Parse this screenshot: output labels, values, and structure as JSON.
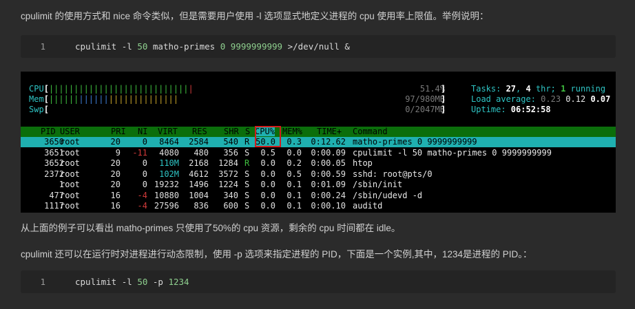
{
  "article": {
    "intro": "cpulimit 的使用方式和 nice 命令类似，但是需要用户使用 -l 选项显式地定义进程的 cpu 使用率上限值。举例说明：",
    "code1": {
      "line_no": "1",
      "cmd": "cpulimit -l ",
      "num1": "50",
      "mid": " matho-primes ",
      "num2": "0",
      "sp": " ",
      "num3": "9999999999",
      "tail": " >/dev/null &"
    },
    "after": "从上面的例子可以看出 matho-primes 只使用了50%的 cpu 资源，剩余的 cpu 时间都在 idle。",
    "dynamic": "cpulimit 还可以在运行时对进程进行动态限制，使用 -p 选项来指定进程的 PID，下面是一个实例,其中，1234是进程的 PID。：",
    "code2": {
      "line_no": "1",
      "cmd": "cpulimit -l ",
      "num1": "50",
      "mid": " -p ",
      "num2": "1234"
    }
  },
  "terminal": {
    "cpu_label": "CPU",
    "mem_label": "Mem",
    "swp_label": "Swp",
    "cpu_value": "51.4%",
    "mem_value": "97/980MB",
    "swp_value": "0/2047MB",
    "cpu_fraction": 0.514,
    "mem_fraction": 0.099,
    "swp_fraction": 0.0,
    "tasks_label": "Tasks: ",
    "tasks_count": "27",
    "tasks_sep": ", ",
    "threads_count": "4",
    "threads_label": " thr; ",
    "running_count": "1",
    "running_label": " running",
    "load_label": "Load average: ",
    "load1": "0.23",
    "load5": "0.12",
    "load15": "0.07",
    "uptime_label": "Uptime: ",
    "uptime": "06:52:58",
    "columns": [
      "PID",
      "USER",
      "PRI",
      "NI",
      "VIRT",
      "RES",
      "SHR",
      "S",
      "CPU%",
      "MEM%",
      "TIME+",
      "Command"
    ],
    "processes": [
      {
        "pid": "3650",
        "user": "root",
        "pri": "20",
        "ni": "0",
        "virt": "8464",
        "res": "2584",
        "shr": "540",
        "s": "R",
        "cpu": "50.0",
        "mem": "0.3",
        "time": "0:12.62",
        "cmd": "matho-primes 0 9999999999"
      },
      {
        "pid": "3651",
        "user": "root",
        "pri": "9",
        "ni": "-11",
        "virt": "4080",
        "res": "480",
        "shr": "356",
        "s": "S",
        "cpu": "0.5",
        "mem": "0.0",
        "time": "0:00.09",
        "cmd": "cpulimit -l 50 matho-primes 0 9999999999"
      },
      {
        "pid": "3652",
        "user": "root",
        "pri": "20",
        "ni": "0",
        "virt": "110M",
        "res": "2168",
        "shr": "1284",
        "s": "R",
        "cpu": "0.0",
        "mem": "0.2",
        "time": "0:00.05",
        "cmd": "htop"
      },
      {
        "pid": "2372",
        "user": "root",
        "pri": "20",
        "ni": "0",
        "virt": "102M",
        "res": "4612",
        "shr": "3572",
        "s": "S",
        "cpu": "0.0",
        "mem": "0.5",
        "time": "0:00.59",
        "cmd": "sshd: root@pts/0"
      },
      {
        "pid": "1",
        "user": "root",
        "pri": "20",
        "ni": "0",
        "virt": "19232",
        "res": "1496",
        "shr": "1224",
        "s": "S",
        "cpu": "0.0",
        "mem": "0.1",
        "time": "0:01.09",
        "cmd": "/sbin/init"
      },
      {
        "pid": "477",
        "user": "root",
        "pri": "16",
        "ni": "-4",
        "virt": "10880",
        "res": "1004",
        "shr": "340",
        "s": "S",
        "cpu": "0.0",
        "mem": "0.1",
        "time": "0:00.24",
        "cmd": "/sbin/udevd -d"
      },
      {
        "pid": "1117",
        "user": "root",
        "pri": "16",
        "ni": "-4",
        "virt": "27596",
        "res": "836",
        "shr": "600",
        "s": "S",
        "cpu": "0.0",
        "mem": "0.1",
        "time": "0:00.10",
        "cmd": "auditd"
      }
    ]
  }
}
